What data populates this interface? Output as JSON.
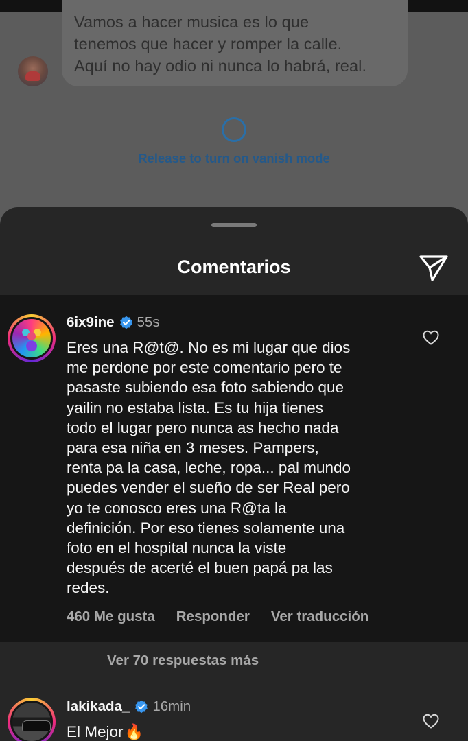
{
  "chat": {
    "message_lines": [
      "Vamos a hacer musica es lo que",
      "tenemos que hacer y romper la calle.",
      "Aquí no hay odio ni nunca lo habrá, real."
    ],
    "vanish_hint": "Release to turn on vanish mode"
  },
  "sheet": {
    "title": "Comentarios",
    "send_icon": "paper-plane-icon"
  },
  "comments": [
    {
      "username": "6ix9ine",
      "verified": true,
      "time": "55s",
      "lines": [
        "Eres una R@t@. No es mi lugar que dios",
        "me perdone por este comentario pero te",
        "pasaste subiendo esa foto sabiendo que",
        "yailin no estaba lista. Es tu hija tienes",
        "todo el lugar pero nunca as hecho nada",
        "para esa niña en 3 meses. Pampers,",
        "renta pa la casa, leche, ropa... pal mundo",
        "puedes vender el sueño de ser Real pero",
        "yo te conosco eres una R@ta la",
        "definición. Por eso tienes solamente una",
        "foto en el hospital nunca la viste",
        "después de acerté el buen papá pa las",
        "redes."
      ],
      "likes": "460 Me gusta",
      "reply": "Responder",
      "translate": "Ver traducción",
      "view_replies": "Ver 70 respuestas más"
    },
    {
      "username": "lakikada_",
      "verified": true,
      "time": "16min",
      "text": "El Mejor",
      "emoji": "🔥"
    }
  ],
  "colors": {
    "verified_blue": "#3897f0",
    "vanish_blue": "#24598a",
    "highlight_bg": "#161616",
    "sheet_bg": "#262626"
  }
}
